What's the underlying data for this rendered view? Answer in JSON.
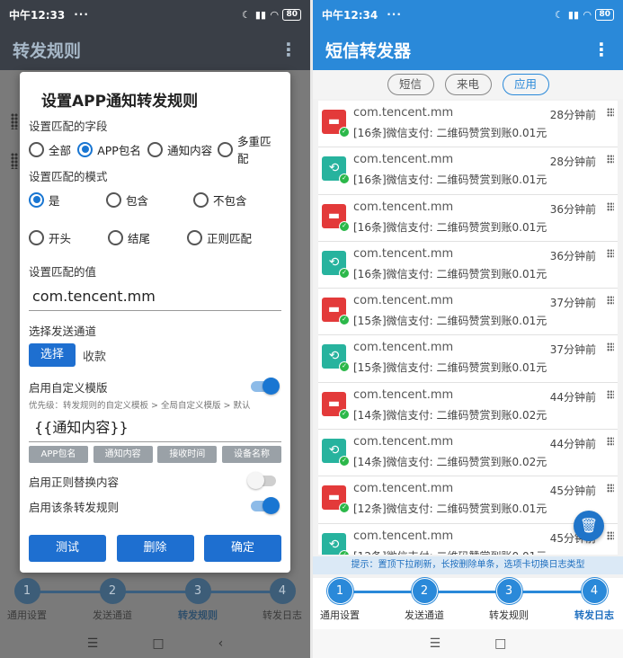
{
  "left": {
    "status": {
      "time": "中午12:33",
      "dots": "···",
      "battery": "80"
    },
    "appbar": {
      "title": "转发规则"
    },
    "dialog": {
      "title": "设置APP通知转发规则",
      "field_section": "设置匹配的字段",
      "field_options": [
        "全部",
        "APP包名",
        "通知内容",
        "多重匹配"
      ],
      "field_selected": "APP包名",
      "mode_section": "设置匹配的模式",
      "mode_options_row1": [
        "是",
        "包含",
        "不包含"
      ],
      "mode_options_row2": [
        "开头",
        "结尾",
        "正则匹配"
      ],
      "mode_selected": "是",
      "value_section": "设置匹配的值",
      "value": "com.tencent.mm",
      "channel_section": "选择发送通道",
      "channel_button": "选择",
      "channel_value": "收款",
      "custom_template_label": "启用自定义模版",
      "custom_template_on": true,
      "priority_hint": "优先级：转发规则的自定义模板 > 全局自定义模版 > 默认",
      "template_value": "{{通知内容}}",
      "template_chips": [
        "APP包名",
        "通知内容",
        "接收时间",
        "设备名称"
      ],
      "regex_replace_label": "启用正则替换内容",
      "regex_replace_on": false,
      "enable_rule_label": "启用该条转发规则",
      "enable_rule_on": true,
      "buttons": {
        "test": "测试",
        "delete": "删除",
        "confirm": "确定"
      }
    },
    "steps": [
      {
        "num": "1",
        "label": "通用设置"
      },
      {
        "num": "2",
        "label": "发送通道"
      },
      {
        "num": "3",
        "label": "转发规则"
      },
      {
        "num": "4",
        "label": "转发日志"
      }
    ],
    "active_step": 3,
    "nav": {
      "menu": "☰",
      "home": "□",
      "back": "‹"
    }
  },
  "right": {
    "status": {
      "time": "中午12:34",
      "dots": "···",
      "battery": "80"
    },
    "appbar": {
      "title": "短信转发器"
    },
    "filters": [
      "短信",
      "来电",
      "应用"
    ],
    "filter_selected": "应用",
    "logs": [
      {
        "pkg": "com.tencent.mm",
        "time": "28分钟前",
        "msg": "[16条]微信支付: 二维码赞赏到账0.01元",
        "icon": "red"
      },
      {
        "pkg": "com.tencent.mm",
        "time": "28分钟前",
        "msg": "[16条]微信支付: 二维码赞赏到账0.01元",
        "icon": "teal"
      },
      {
        "pkg": "com.tencent.mm",
        "time": "36分钟前",
        "msg": "[16条]微信支付: 二维码赞赏到账0.01元",
        "icon": "red"
      },
      {
        "pkg": "com.tencent.mm",
        "time": "36分钟前",
        "msg": "[16条]微信支付: 二维码赞赏到账0.01元",
        "icon": "teal"
      },
      {
        "pkg": "com.tencent.mm",
        "time": "37分钟前",
        "msg": "[15条]微信支付: 二维码赞赏到账0.01元",
        "icon": "red"
      },
      {
        "pkg": "com.tencent.mm",
        "time": "37分钟前",
        "msg": "[15条]微信支付: 二维码赞赏到账0.01元",
        "icon": "teal"
      },
      {
        "pkg": "com.tencent.mm",
        "time": "44分钟前",
        "msg": "[14条]微信支付: 二维码赞赏到账0.02元",
        "icon": "red"
      },
      {
        "pkg": "com.tencent.mm",
        "time": "44分钟前",
        "msg": "[14条]微信支付: 二维码赞赏到账0.02元",
        "icon": "teal"
      },
      {
        "pkg": "com.tencent.mm",
        "time": "45分钟前",
        "msg": "[12条]微信支付: 二维码赞赏到账0.01元",
        "icon": "red"
      },
      {
        "pkg": "com.tencent.mm",
        "time": "45分钟前",
        "msg": "[12条]微信支付: 二维码赞赏到账0.01元",
        "icon": "teal"
      }
    ],
    "tip": "提示：置顶下拉刷新，长按删除单条，选项卡切换日志类型",
    "steps": [
      {
        "num": "1",
        "label": "通用设置"
      },
      {
        "num": "2",
        "label": "发送通道"
      },
      {
        "num": "3",
        "label": "转发规则"
      },
      {
        "num": "4",
        "label": "转发日志"
      }
    ],
    "active_step": 4,
    "nav": {
      "menu": "☰",
      "home": "□"
    }
  },
  "colors": {
    "primary": "#2a89d9",
    "dialog_button": "#1e6fd0",
    "alert_red": "#e33a3a",
    "app_teal": "#27b39e"
  }
}
